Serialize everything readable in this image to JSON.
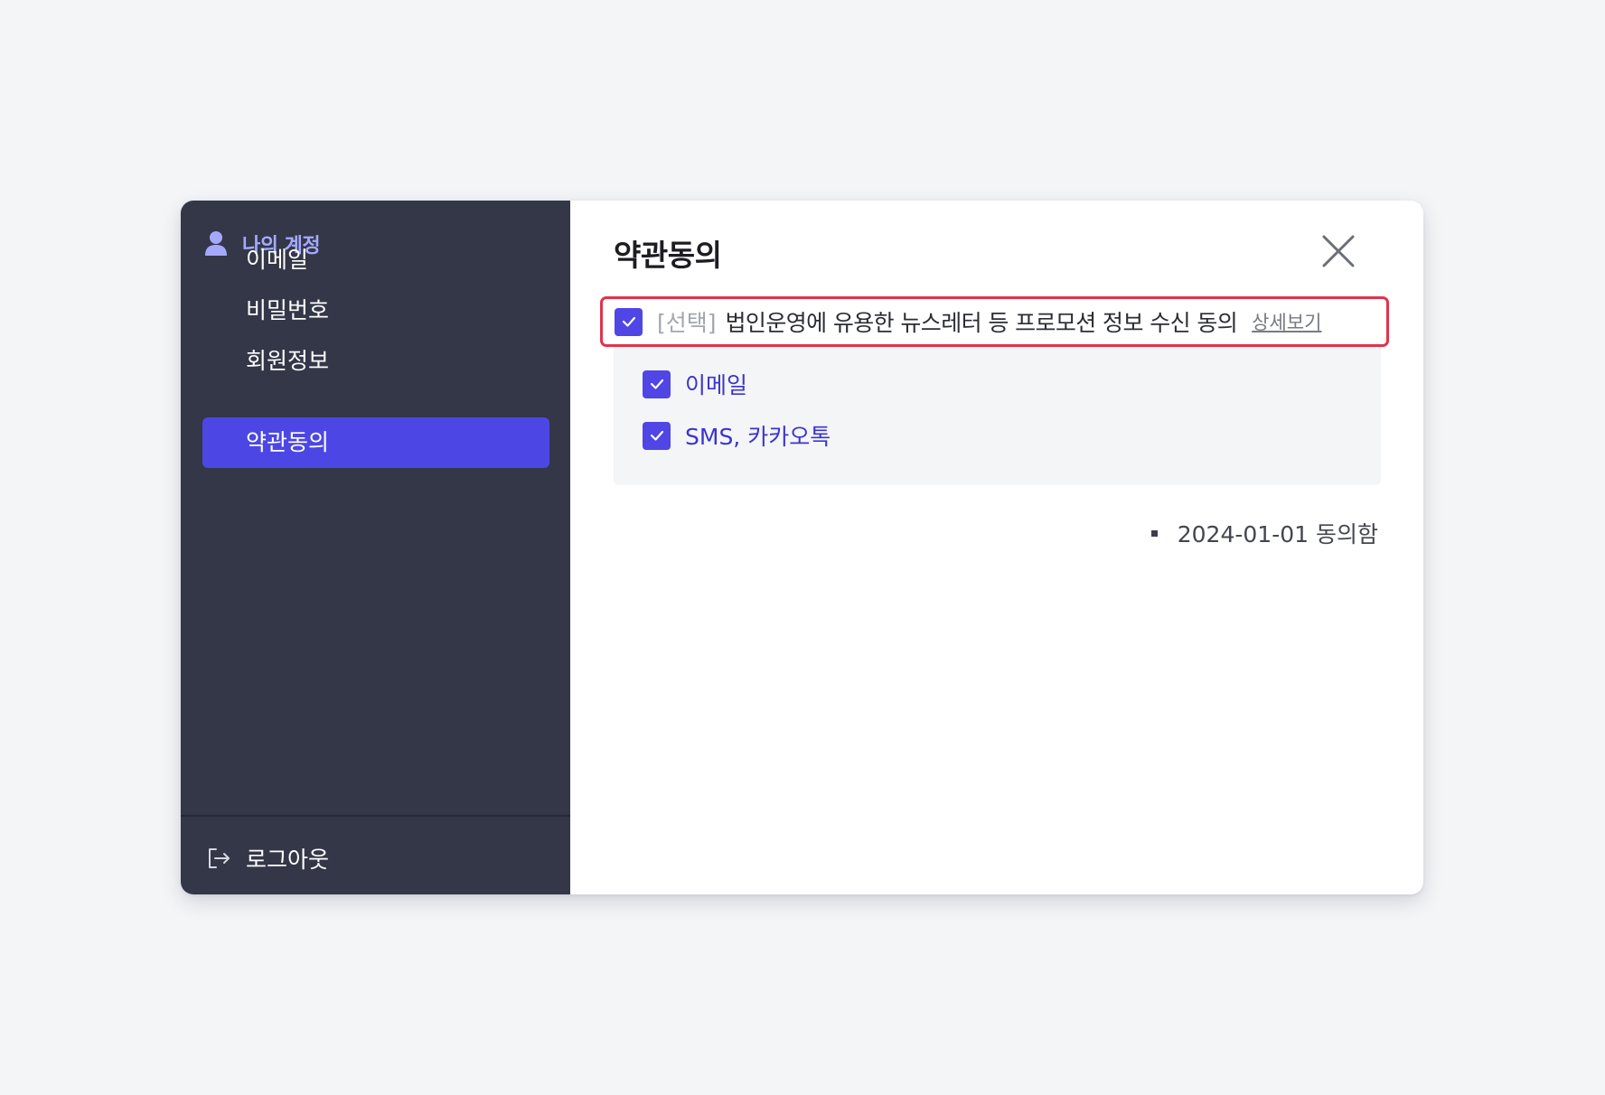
{
  "sidebar": {
    "header_label": "나의 계정",
    "items": [
      {
        "label": "이메일"
      },
      {
        "label": "비밀번호"
      },
      {
        "label": "회원정보"
      },
      {
        "label": "약관동의",
        "active": true
      }
    ],
    "logout_label": "로그아웃"
  },
  "content": {
    "title": "약관동의",
    "consent": {
      "tag": "[선택]",
      "text": "법인운영에 유용한 뉴스레터 등 프로모션 정보 수신 동의",
      "detail_link": "상세보기",
      "checked": true
    },
    "channels": [
      {
        "label": "이메일",
        "checked": true
      },
      {
        "label": "SMS, 카카오톡",
        "checked": true
      }
    ],
    "agreed_date": "2024-01-01 동의함"
  },
  "colors": {
    "sidebar_bg": "#333748",
    "accent": "#4c47e4",
    "header_accent": "#a4a9ff",
    "highlight_border": "#e2334a",
    "channel_text": "#3b34cf"
  },
  "icons": {
    "header": "user-icon",
    "logout": "logout-icon",
    "close": "close-icon",
    "check": "check-icon"
  }
}
